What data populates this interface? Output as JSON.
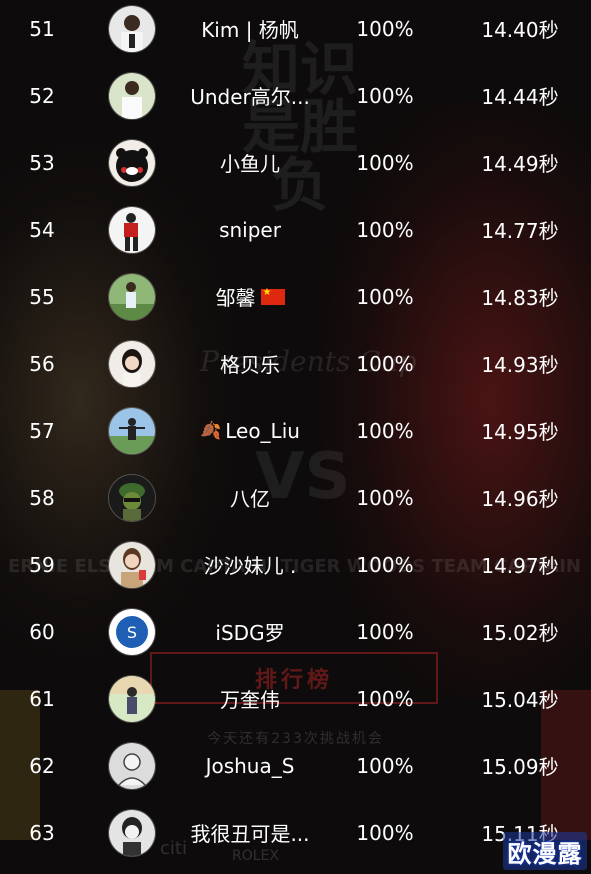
{
  "leaderboard": {
    "rows": [
      {
        "rank": "51",
        "name": "Kim | 杨帆",
        "percent": "100%",
        "time": "14.40秒",
        "avatar": "portrait-man-white-shirt"
      },
      {
        "rank": "52",
        "name": "Under高尔...",
        "percent": "100%",
        "time": "14.44秒",
        "avatar": "golfer-white-shirt"
      },
      {
        "rank": "53",
        "name": "小鱼儿",
        "percent": "100%",
        "time": "14.49秒",
        "avatar": "kumamon-bear"
      },
      {
        "rank": "54",
        "name": "sniper",
        "percent": "100%",
        "time": "14.77秒",
        "avatar": "golfer-red-shirt"
      },
      {
        "rank": "55",
        "name": "邹馨",
        "percent": "100%",
        "time": "14.83秒",
        "avatar": "golfer-outdoor",
        "flag": "china-flag-icon"
      },
      {
        "rank": "56",
        "name": "格贝乐",
        "percent": "100%",
        "time": "14.93秒",
        "avatar": "woman-portrait"
      },
      {
        "rank": "57",
        "name": "Leo_Liu",
        "percent": "100%",
        "time": "14.95秒",
        "avatar": "person-on-course",
        "prefix_icon": "leaf-icon"
      },
      {
        "rank": "58",
        "name": "八亿",
        "percent": "100%",
        "time": "14.96秒",
        "avatar": "cartoon-soldier"
      },
      {
        "rank": "59",
        "name": "沙沙妹儿 .",
        "percent": "100%",
        "time": "14.97秒",
        "avatar": "woman-with-cup"
      },
      {
        "rank": "60",
        "name": "iSDG罗",
        "percent": "100%",
        "time": "15.02秒",
        "avatar": "blue-logo"
      },
      {
        "rank": "61",
        "name": "万奎伟",
        "percent": "100%",
        "time": "15.04秒",
        "avatar": "person-in-park"
      },
      {
        "rank": "62",
        "name": "Joshua_S",
        "percent": "100%",
        "time": "15.09秒",
        "avatar": "grey-default"
      },
      {
        "rank": "63",
        "name": "我很丑可是...",
        "percent": "100%",
        "time": "15.11秒",
        "avatar": "grey-sketch"
      }
    ]
  },
  "background": {
    "big_text": "知识 是胜负",
    "cup_text": "Presidents Cup",
    "vs_text": "VS",
    "captain_left": "ERNIE ELS TEAM CAPTAIN",
    "captain_right": "TIGER WOODS TEAM CAPTAIN",
    "rank_button": "排行榜",
    "chances_text": "今天还有233次挑战机会",
    "sponsor_left": "citi",
    "sponsor_center": "ROLEX"
  },
  "watermark": "欧漫露",
  "colors": {
    "background": "#0d0b0b",
    "text": "#ffffff",
    "accent_red": "#c82828",
    "accent_gold": "#c8a028"
  }
}
